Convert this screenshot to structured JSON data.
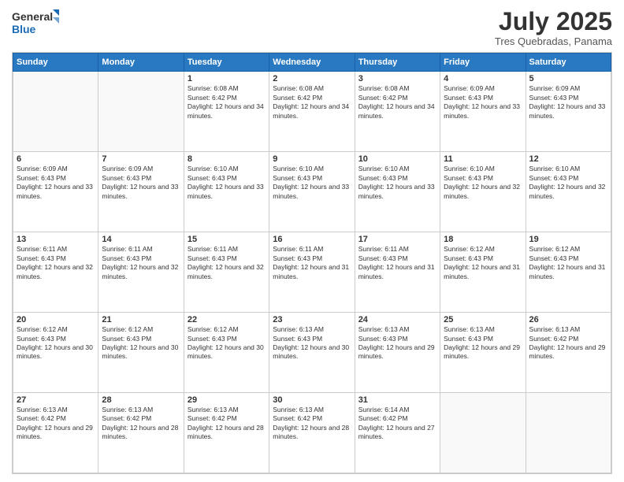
{
  "logo": {
    "line1": "General",
    "line2": "Blue"
  },
  "header": {
    "month_year": "July 2025",
    "location": "Tres Quebradas, Panama"
  },
  "days_of_week": [
    "Sunday",
    "Monday",
    "Tuesday",
    "Wednesday",
    "Thursday",
    "Friday",
    "Saturday"
  ],
  "weeks": [
    [
      {
        "day": "",
        "info": ""
      },
      {
        "day": "",
        "info": ""
      },
      {
        "day": "1",
        "info": "Sunrise: 6:08 AM\nSunset: 6:42 PM\nDaylight: 12 hours and 34 minutes."
      },
      {
        "day": "2",
        "info": "Sunrise: 6:08 AM\nSunset: 6:42 PM\nDaylight: 12 hours and 34 minutes."
      },
      {
        "day": "3",
        "info": "Sunrise: 6:08 AM\nSunset: 6:42 PM\nDaylight: 12 hours and 34 minutes."
      },
      {
        "day": "4",
        "info": "Sunrise: 6:09 AM\nSunset: 6:43 PM\nDaylight: 12 hours and 33 minutes."
      },
      {
        "day": "5",
        "info": "Sunrise: 6:09 AM\nSunset: 6:43 PM\nDaylight: 12 hours and 33 minutes."
      }
    ],
    [
      {
        "day": "6",
        "info": "Sunrise: 6:09 AM\nSunset: 6:43 PM\nDaylight: 12 hours and 33 minutes."
      },
      {
        "day": "7",
        "info": "Sunrise: 6:09 AM\nSunset: 6:43 PM\nDaylight: 12 hours and 33 minutes."
      },
      {
        "day": "8",
        "info": "Sunrise: 6:10 AM\nSunset: 6:43 PM\nDaylight: 12 hours and 33 minutes."
      },
      {
        "day": "9",
        "info": "Sunrise: 6:10 AM\nSunset: 6:43 PM\nDaylight: 12 hours and 33 minutes."
      },
      {
        "day": "10",
        "info": "Sunrise: 6:10 AM\nSunset: 6:43 PM\nDaylight: 12 hours and 33 minutes."
      },
      {
        "day": "11",
        "info": "Sunrise: 6:10 AM\nSunset: 6:43 PM\nDaylight: 12 hours and 32 minutes."
      },
      {
        "day": "12",
        "info": "Sunrise: 6:10 AM\nSunset: 6:43 PM\nDaylight: 12 hours and 32 minutes."
      }
    ],
    [
      {
        "day": "13",
        "info": "Sunrise: 6:11 AM\nSunset: 6:43 PM\nDaylight: 12 hours and 32 minutes."
      },
      {
        "day": "14",
        "info": "Sunrise: 6:11 AM\nSunset: 6:43 PM\nDaylight: 12 hours and 32 minutes."
      },
      {
        "day": "15",
        "info": "Sunrise: 6:11 AM\nSunset: 6:43 PM\nDaylight: 12 hours and 32 minutes."
      },
      {
        "day": "16",
        "info": "Sunrise: 6:11 AM\nSunset: 6:43 PM\nDaylight: 12 hours and 31 minutes."
      },
      {
        "day": "17",
        "info": "Sunrise: 6:11 AM\nSunset: 6:43 PM\nDaylight: 12 hours and 31 minutes."
      },
      {
        "day": "18",
        "info": "Sunrise: 6:12 AM\nSunset: 6:43 PM\nDaylight: 12 hours and 31 minutes."
      },
      {
        "day": "19",
        "info": "Sunrise: 6:12 AM\nSunset: 6:43 PM\nDaylight: 12 hours and 31 minutes."
      }
    ],
    [
      {
        "day": "20",
        "info": "Sunrise: 6:12 AM\nSunset: 6:43 PM\nDaylight: 12 hours and 30 minutes."
      },
      {
        "day": "21",
        "info": "Sunrise: 6:12 AM\nSunset: 6:43 PM\nDaylight: 12 hours and 30 minutes."
      },
      {
        "day": "22",
        "info": "Sunrise: 6:12 AM\nSunset: 6:43 PM\nDaylight: 12 hours and 30 minutes."
      },
      {
        "day": "23",
        "info": "Sunrise: 6:13 AM\nSunset: 6:43 PM\nDaylight: 12 hours and 30 minutes."
      },
      {
        "day": "24",
        "info": "Sunrise: 6:13 AM\nSunset: 6:43 PM\nDaylight: 12 hours and 29 minutes."
      },
      {
        "day": "25",
        "info": "Sunrise: 6:13 AM\nSunset: 6:43 PM\nDaylight: 12 hours and 29 minutes."
      },
      {
        "day": "26",
        "info": "Sunrise: 6:13 AM\nSunset: 6:42 PM\nDaylight: 12 hours and 29 minutes."
      }
    ],
    [
      {
        "day": "27",
        "info": "Sunrise: 6:13 AM\nSunset: 6:42 PM\nDaylight: 12 hours and 29 minutes."
      },
      {
        "day": "28",
        "info": "Sunrise: 6:13 AM\nSunset: 6:42 PM\nDaylight: 12 hours and 28 minutes."
      },
      {
        "day": "29",
        "info": "Sunrise: 6:13 AM\nSunset: 6:42 PM\nDaylight: 12 hours and 28 minutes."
      },
      {
        "day": "30",
        "info": "Sunrise: 6:13 AM\nSunset: 6:42 PM\nDaylight: 12 hours and 28 minutes."
      },
      {
        "day": "31",
        "info": "Sunrise: 6:14 AM\nSunset: 6:42 PM\nDaylight: 12 hours and 27 minutes."
      },
      {
        "day": "",
        "info": ""
      },
      {
        "day": "",
        "info": ""
      }
    ]
  ]
}
